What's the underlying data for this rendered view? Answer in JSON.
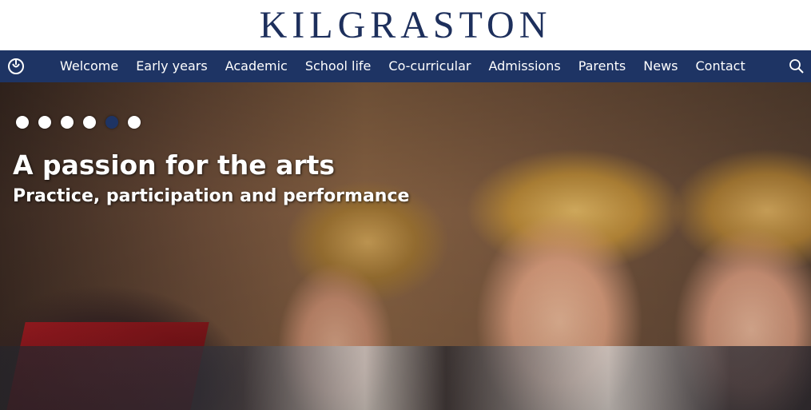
{
  "brand": {
    "title": "KILGRASTON"
  },
  "nav": {
    "items": [
      {
        "label": "Welcome"
      },
      {
        "label": "Early years"
      },
      {
        "label": "Academic"
      },
      {
        "label": "School life"
      },
      {
        "label": "Co-curricular"
      },
      {
        "label": "Admissions"
      },
      {
        "label": "Parents"
      },
      {
        "label": "News"
      },
      {
        "label": "Contact"
      }
    ],
    "icons": {
      "logo": "crest-logo-icon",
      "search": "search-icon"
    }
  },
  "hero": {
    "title": "A passion for the arts",
    "subtitle": "Practice, participation and performance",
    "slide_count": 6,
    "active_slide": 5
  },
  "colors": {
    "navy": "#1e3464",
    "brand_text": "#1d2f5c",
    "white": "#ffffff"
  }
}
